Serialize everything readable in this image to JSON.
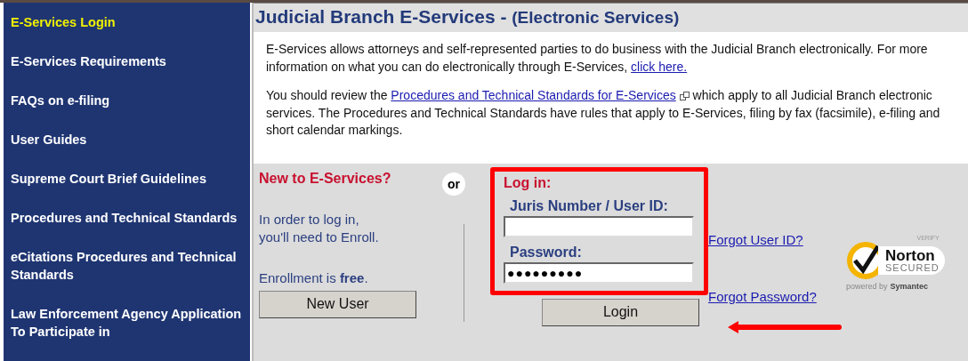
{
  "sidebar": {
    "items": [
      {
        "label": "E-Services Login",
        "selected": true
      },
      {
        "label": "E-Services Requirements",
        "selected": false
      },
      {
        "label": "FAQs on e-filing",
        "selected": false
      },
      {
        "label": "User Guides",
        "selected": false
      },
      {
        "label": "Supreme Court Brief Guidelines",
        "selected": false
      },
      {
        "label": "Procedures and Technical Standards",
        "selected": false
      },
      {
        "label": "eCitations Procedures and Technical Standards",
        "selected": false
      },
      {
        "label": "Law Enforcement Agency Application To Participate in",
        "selected": false
      }
    ]
  },
  "header": {
    "title": "Judicial Branch E-Services - ",
    "subtitle": "(Electronic Services)"
  },
  "paragraphs": [
    [
      {
        "kind": "text",
        "text": "E-Services allows attorneys and self-represented parties to do business with the Judicial Branch electronically. For more information on what you can do electronically through E-Services, "
      },
      {
        "kind": "link",
        "text": "click here."
      }
    ],
    [
      {
        "kind": "text",
        "text": "You should review the "
      },
      {
        "kind": "link",
        "text": "Procedures and Technical Standards for E-Services"
      },
      {
        "kind": "external"
      },
      {
        "kind": "text",
        "text": " which apply to all Judicial Branch electronic services. The Procedures and Technical Standards have rules that apply to E-Services, filing by fax (facsimile), e-filing and short calendar markings."
      }
    ]
  ],
  "new_user": {
    "heading": "New to E-Services?",
    "text": "In order to log in, you'll need to Enroll.",
    "enroll_note": "Enrollment is **free**.",
    "button": "New User"
  },
  "or_badge": "or",
  "login": {
    "heading": "Log in:",
    "user_label": "Juris Number / User ID:",
    "password_label": "Password:",
    "password_value": "●●●●●●●●●",
    "button": "Login",
    "forgot_user": "Forgot User ID?",
    "forgot_password": "Forgot Password?"
  },
  "seal": {
    "verify": "VERIFY",
    "brand": "Norton",
    "secured": "SECURED",
    "powered": "powered by",
    "company": "Symantec"
  }
}
